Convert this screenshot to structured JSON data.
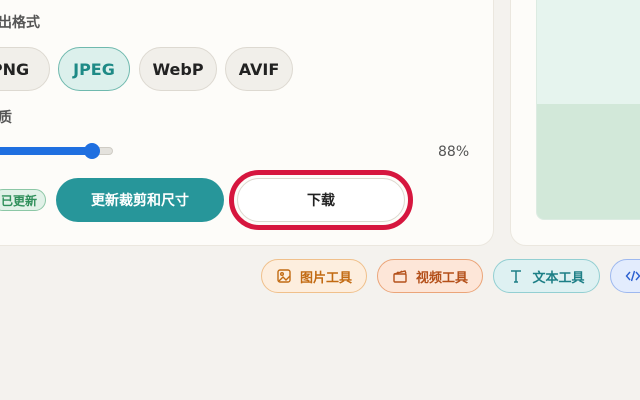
{
  "settings": {
    "format_label": "出格式",
    "formats": [
      {
        "label": "PNG",
        "active": false
      },
      {
        "label": "JPEG",
        "active": true
      },
      {
        "label": "WebP",
        "active": false
      },
      {
        "label": "AVIF",
        "active": false
      }
    ],
    "quality_label": "质",
    "quality": {
      "value_text": "88%",
      "fraction": 0.86
    },
    "updated_badge": "已更新",
    "update_button": "更新裁剪和尺寸",
    "download_button": "下载"
  },
  "tools": [
    {
      "label": "图片工具",
      "icon": "image-icon"
    },
    {
      "label": "视频工具",
      "icon": "clapperboard-icon"
    },
    {
      "label": "文本工具",
      "icon": "text-icon"
    },
    {
      "label": "",
      "icon": "code-icon"
    }
  ],
  "colors": {
    "accent": "#27969a",
    "slider": "#1f6fe0",
    "highlight": "#d6163e"
  }
}
